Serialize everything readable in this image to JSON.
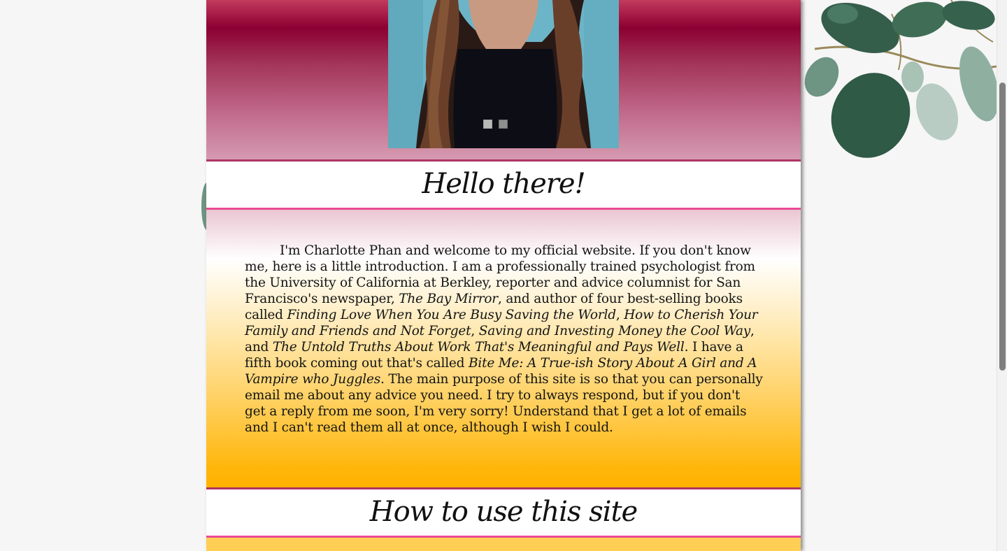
{
  "hero": {
    "slider_dots": [
      {
        "active": true
      },
      {
        "active": false
      }
    ]
  },
  "sections": {
    "hello": {
      "heading": "Hello there!"
    },
    "how_to": {
      "heading": "How to use this site"
    }
  },
  "intro": {
    "p1": "I'm Charlotte Phan and welcome to my official website. If you don't know me, here is a little introduction. I am a professionally trained psychologist from the University of California at Berkley, reporter and advice columnist for San Francisco's newspaper, ",
    "newspaper": "The Bay Mirror",
    "p2": ", and author of four best-selling books called ",
    "book1": "Finding Love When You Are Busy Saving the World",
    "sep1": ", ",
    "book2": "How to Cherish Your Family and Friends and Not Forget",
    "sep2": ", ",
    "book3": "Saving and Investing Money the Cool Way",
    "sep3": ", and ",
    "book4": "The Untold Truths About Work That's Meaningful and Pays Well",
    "p3": ". I have a fifth book coming out that's called ",
    "book5": "Bite Me: A True-ish Story About A Girl and A Vampire who Juggles",
    "p4": ". The main purpose of this site is so that you can personally email me about any advice you need. I try to always respond, but if you don't get a reply from me soon, I'm very sorry! Understand that I get a lot of emails and I can't read them all at once, although I wish I could."
  },
  "colors": {
    "hero_crimson": "#8c0032",
    "border_top": "#b03464",
    "border_bottom": "#e94a95",
    "amber": "#ffb300"
  },
  "icons": {
    "leaves": "eucalyptus-leaves-decor"
  }
}
